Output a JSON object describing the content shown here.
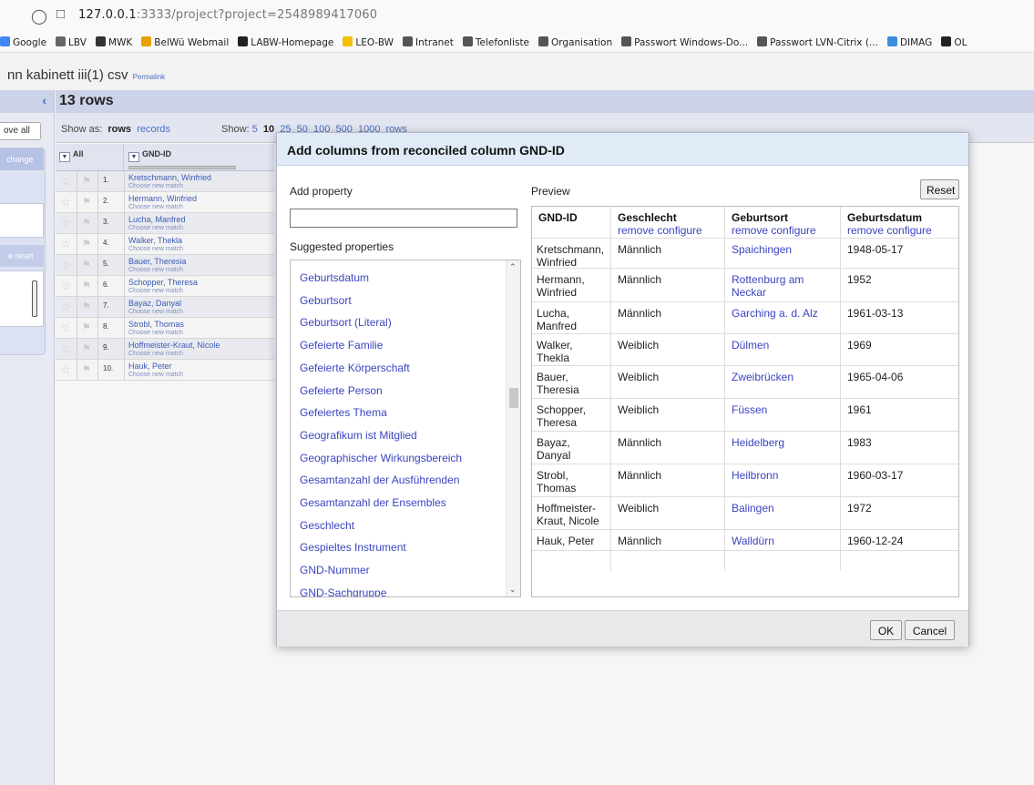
{
  "browser": {
    "url_host": "127.0.0.1",
    "url_rest": ":3333/project?project=2548989417060",
    "bookmarks": [
      {
        "label": "Google",
        "color": "#4285f4"
      },
      {
        "label": "LBV",
        "color": "#666666"
      },
      {
        "label": "MWK",
        "color": "#333333"
      },
      {
        "label": "BelWü Webmail",
        "color": "#e8a000"
      },
      {
        "label": "LABW-Homepage",
        "color": "#222222"
      },
      {
        "label": "LEO-BW",
        "color": "#f5c000"
      },
      {
        "label": "Intranet",
        "color": "#555555"
      },
      {
        "label": "Telefonliste",
        "color": "#555555"
      },
      {
        "label": "Organisation",
        "color": "#555555"
      },
      {
        "label": "Passwort Windows-Do...",
        "color": "#555555"
      },
      {
        "label": "Passwort LVN-Citrix (...",
        "color": "#555555"
      },
      {
        "label": "DIMAG",
        "color": "#3a8ee0"
      },
      {
        "label": "OL",
        "color": "#222222"
      }
    ]
  },
  "app": {
    "project_title": "nn kabinett iii(1) csv",
    "permalink": "Permalink"
  },
  "left": {
    "remove_all": "ove all",
    "change": "change",
    "reset": "e reset"
  },
  "grid": {
    "rows_count": "13 rows",
    "show_as_label": "Show as:",
    "rows_mode": "rows",
    "records_mode": "records",
    "show_label": "Show:",
    "page_sizes": [
      "5",
      "10",
      "25",
      "50",
      "100",
      "500",
      "1000"
    ],
    "page_sizes_suffix": "rows",
    "col_all": "All",
    "col_gnd": "GND-ID",
    "choose_new_match": "Choose new match",
    "rows": [
      {
        "num": "1.",
        "name": "Kretschmann, Winfried"
      },
      {
        "num": "2.",
        "name": "Hermann, Winfried"
      },
      {
        "num": "3.",
        "name": "Lucha, Manfred"
      },
      {
        "num": "4.",
        "name": "Walker, Thekla"
      },
      {
        "num": "5.",
        "name": "Bauer, Theresia"
      },
      {
        "num": "6.",
        "name": "Schopper, Theresa"
      },
      {
        "num": "7.",
        "name": "Bayaz, Danyal"
      },
      {
        "num": "8.",
        "name": "Strobl, Thomas"
      },
      {
        "num": "9.",
        "name": "Hoffmeister-Kraut, Nicole"
      },
      {
        "num": "10.",
        "name": "Hauk, Peter"
      }
    ]
  },
  "dialog": {
    "title": "Add columns from reconciled column GND-ID",
    "add_property_label": "Add property",
    "add_property_value": "",
    "suggested_label": "Suggested properties",
    "suggested": [
      "Geburtsdatum",
      "Geburtsort",
      "Geburtsort (Literal)",
      "Gefeierte Familie",
      "Gefeierte Körperschaft",
      "Gefeierte Person",
      "Gefeiertes Thema",
      "Geografikum ist Mitglied",
      "Geographischer Wirkungsbereich",
      "Gesamtanzahl der Ausführenden",
      "Gesamtanzahl der Ensembles",
      "Geschlecht",
      "Gespieltes Instrument",
      "GND-Nummer",
      "GND-Sachgruppe"
    ],
    "preview_label": "Preview",
    "reset_button": "Reset",
    "preview_headers": {
      "gnd": "GND-ID",
      "geschlecht": "Geschlecht",
      "geburtsort": "Geburtsort",
      "geburtsdatum": "Geburtsdatum",
      "remove": "remove",
      "configure": "configure"
    },
    "preview_rows": [
      {
        "gnd1": "Kretschmann,",
        "gnd2": "Winfried",
        "sex": "Männlich",
        "place1": "Spaichingen",
        "place2": "",
        "date": "1948-05-17"
      },
      {
        "gnd1": "Hermann,",
        "gnd2": "Winfried",
        "sex": "Männlich",
        "place1": "Rottenburg am",
        "place2": "Neckar",
        "date": "1952"
      },
      {
        "gnd1": "Lucha,",
        "gnd2": "Manfred",
        "sex": "Männlich",
        "place1": "Garching a. d. Alz",
        "place2": "",
        "date": "1961-03-13"
      },
      {
        "gnd1": "Walker,",
        "gnd2": "Thekla",
        "sex": "Weiblich",
        "place1": "Dülmen",
        "place2": "",
        "date": "1969"
      },
      {
        "gnd1": "Bauer,",
        "gnd2": "Theresia",
        "sex": "Weiblich",
        "place1": "Zweibrücken",
        "place2": "",
        "date": "1965-04-06"
      },
      {
        "gnd1": "Schopper,",
        "gnd2": "Theresa",
        "sex": "Weiblich",
        "place1": "Füssen",
        "place2": "",
        "date": "1961"
      },
      {
        "gnd1": "Bayaz,",
        "gnd2": "Danyal",
        "sex": "Männlich",
        "place1": "Heidelberg",
        "place2": "",
        "date": "1983"
      },
      {
        "gnd1": "Strobl,",
        "gnd2": "Thomas",
        "sex": "Männlich",
        "place1": "Heilbronn",
        "place2": "",
        "date": "1960-03-17"
      },
      {
        "gnd1": "Hoffmeister-",
        "gnd2": "Kraut, Nicole",
        "sex": "Weiblich",
        "place1": "Balingen",
        "place2": "",
        "date": "1972"
      },
      {
        "gnd1": "Hauk, Peter",
        "gnd2": "",
        "sex": "Männlich",
        "place1": "Walldürn",
        "place2": "",
        "date": "1960-12-24"
      }
    ],
    "ok_button": "OK",
    "cancel_button": "Cancel"
  }
}
